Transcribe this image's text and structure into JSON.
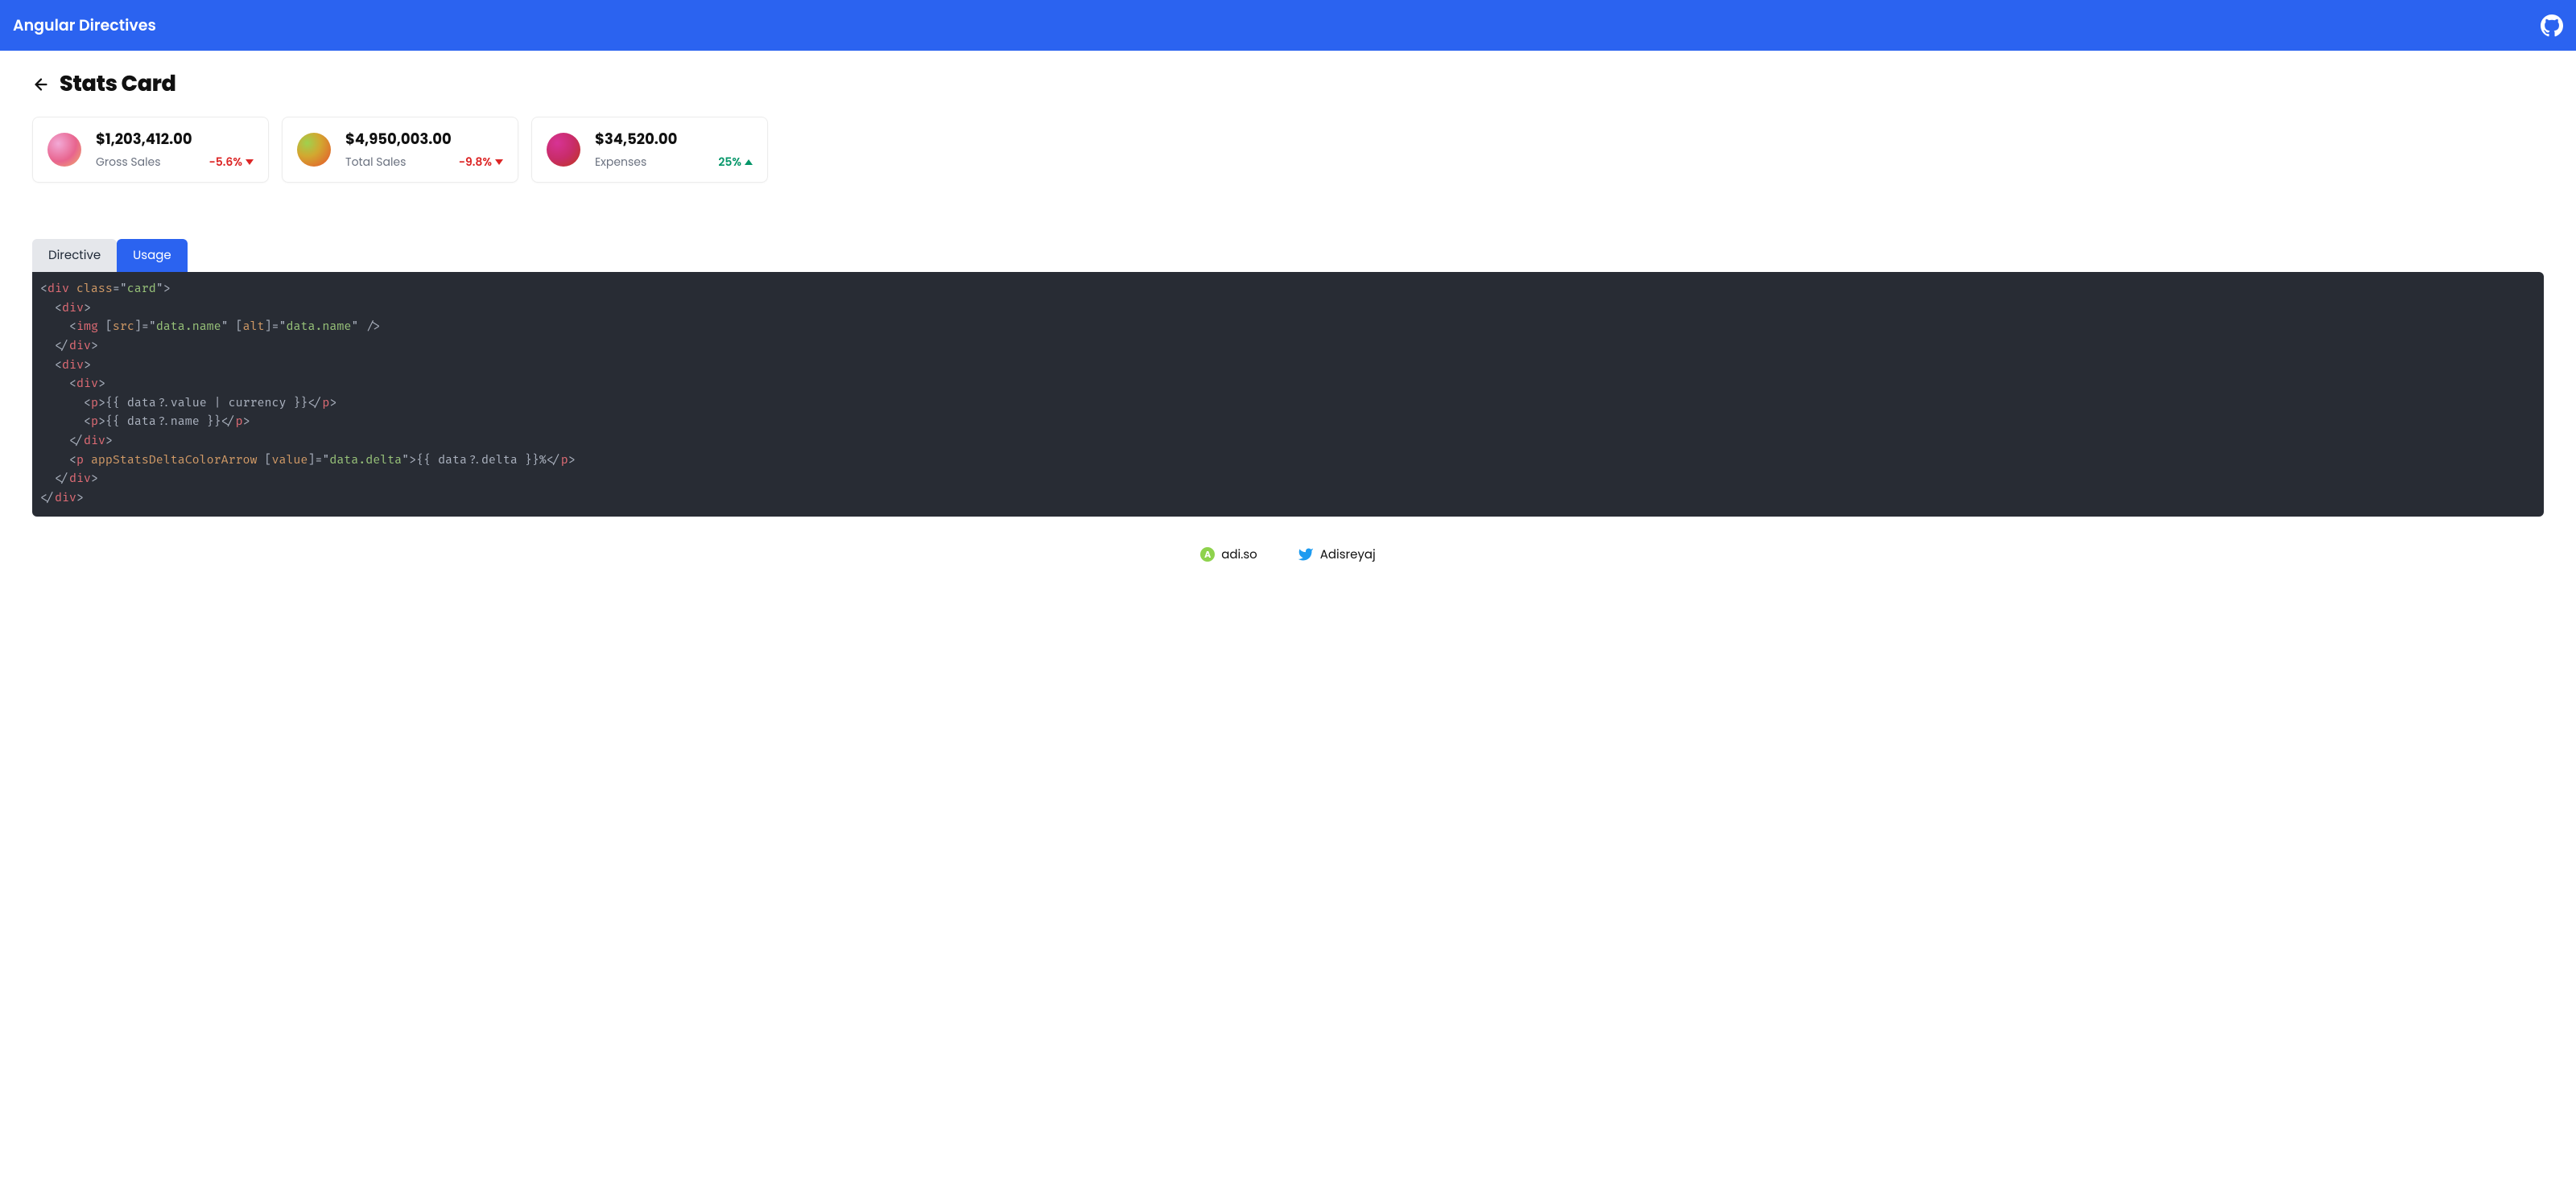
{
  "header": {
    "title": "Angular Directives"
  },
  "page": {
    "title": "Stats Card"
  },
  "cards": [
    {
      "value": "$1,203,412.00",
      "name": "Gross Sales",
      "delta": "-5.6%",
      "direction": "down"
    },
    {
      "value": "$4,950,003.00",
      "name": "Total Sales",
      "delta": "-9.8%",
      "direction": "down"
    },
    {
      "value": "$34,520.00",
      "name": "Expenses",
      "delta": "25%",
      "direction": "up"
    }
  ],
  "tabs": {
    "directive": "Directive",
    "usage": "Usage",
    "active": "usage"
  },
  "code": {
    "lines": [
      {
        "indent": 0,
        "tokens": [
          {
            "t": "punc",
            "v": "<"
          },
          {
            "t": "tag",
            "v": "div"
          },
          {
            "t": "plain",
            "v": " "
          },
          {
            "t": "attr",
            "v": "class"
          },
          {
            "t": "punc",
            "v": "="
          },
          {
            "t": "punc",
            "v": "\""
          },
          {
            "t": "str",
            "v": "card"
          },
          {
            "t": "punc",
            "v": "\""
          },
          {
            "t": "punc",
            "v": ">"
          }
        ]
      },
      {
        "indent": 1,
        "tokens": [
          {
            "t": "punc",
            "v": "<"
          },
          {
            "t": "tag",
            "v": "div"
          },
          {
            "t": "punc",
            "v": ">"
          }
        ]
      },
      {
        "indent": 2,
        "tokens": [
          {
            "t": "punc",
            "v": "<"
          },
          {
            "t": "tag",
            "v": "img"
          },
          {
            "t": "plain",
            "v": " "
          },
          {
            "t": "punc",
            "v": "["
          },
          {
            "t": "attr",
            "v": "src"
          },
          {
            "t": "punc",
            "v": "]"
          },
          {
            "t": "punc",
            "v": "="
          },
          {
            "t": "punc",
            "v": "\""
          },
          {
            "t": "str",
            "v": "data.name"
          },
          {
            "t": "punc",
            "v": "\""
          },
          {
            "t": "plain",
            "v": " "
          },
          {
            "t": "punc",
            "v": "["
          },
          {
            "t": "attr",
            "v": "alt"
          },
          {
            "t": "punc",
            "v": "]"
          },
          {
            "t": "punc",
            "v": "="
          },
          {
            "t": "punc",
            "v": "\""
          },
          {
            "t": "str",
            "v": "data.name"
          },
          {
            "t": "punc",
            "v": "\""
          },
          {
            "t": "plain",
            "v": " "
          },
          {
            "t": "punc",
            "v": "/>"
          }
        ]
      },
      {
        "indent": 1,
        "tokens": [
          {
            "t": "punc",
            "v": "</"
          },
          {
            "t": "tag",
            "v": "div"
          },
          {
            "t": "punc",
            "v": ">"
          }
        ]
      },
      {
        "indent": 1,
        "tokens": [
          {
            "t": "punc",
            "v": "<"
          },
          {
            "t": "tag",
            "v": "div"
          },
          {
            "t": "punc",
            "v": ">"
          }
        ]
      },
      {
        "indent": 2,
        "tokens": [
          {
            "t": "punc",
            "v": "<"
          },
          {
            "t": "tag",
            "v": "div"
          },
          {
            "t": "punc",
            "v": ">"
          }
        ]
      },
      {
        "indent": 3,
        "tokens": [
          {
            "t": "punc",
            "v": "<"
          },
          {
            "t": "tag",
            "v": "p"
          },
          {
            "t": "punc",
            "v": ">"
          },
          {
            "t": "plain",
            "v": "{{ data?.value | currency }}"
          },
          {
            "t": "punc",
            "v": "</"
          },
          {
            "t": "tag",
            "v": "p"
          },
          {
            "t": "punc",
            "v": ">"
          }
        ]
      },
      {
        "indent": 3,
        "tokens": [
          {
            "t": "punc",
            "v": "<"
          },
          {
            "t": "tag",
            "v": "p"
          },
          {
            "t": "punc",
            "v": ">"
          },
          {
            "t": "plain",
            "v": "{{ data?.name }}"
          },
          {
            "t": "punc",
            "v": "</"
          },
          {
            "t": "tag",
            "v": "p"
          },
          {
            "t": "punc",
            "v": ">"
          }
        ]
      },
      {
        "indent": 2,
        "tokens": [
          {
            "t": "punc",
            "v": "</"
          },
          {
            "t": "tag",
            "v": "div"
          },
          {
            "t": "punc",
            "v": ">"
          }
        ]
      },
      {
        "indent": 2,
        "tokens": [
          {
            "t": "punc",
            "v": "<"
          },
          {
            "t": "tag",
            "v": "p"
          },
          {
            "t": "plain",
            "v": " "
          },
          {
            "t": "attr",
            "v": "appStatsDeltaColorArrow"
          },
          {
            "t": "plain",
            "v": " "
          },
          {
            "t": "punc",
            "v": "["
          },
          {
            "t": "attr",
            "v": "value"
          },
          {
            "t": "punc",
            "v": "]"
          },
          {
            "t": "punc",
            "v": "="
          },
          {
            "t": "punc",
            "v": "\""
          },
          {
            "t": "str",
            "v": "data.delta"
          },
          {
            "t": "punc",
            "v": "\""
          },
          {
            "t": "punc",
            "v": ">"
          },
          {
            "t": "plain",
            "v": "{{ data?.delta }}%"
          },
          {
            "t": "punc",
            "v": "</"
          },
          {
            "t": "tag",
            "v": "p"
          },
          {
            "t": "punc",
            "v": ">"
          }
        ]
      },
      {
        "indent": 1,
        "tokens": [
          {
            "t": "punc",
            "v": "</"
          },
          {
            "t": "tag",
            "v": "div"
          },
          {
            "t": "punc",
            "v": ">"
          }
        ]
      },
      {
        "indent": 0,
        "tokens": [
          {
            "t": "punc",
            "v": "</"
          },
          {
            "t": "tag",
            "v": "div"
          },
          {
            "t": "punc",
            "v": ">"
          }
        ]
      }
    ]
  },
  "footer": {
    "adiso": "adi.so",
    "twitter": "Adisreyaj"
  }
}
